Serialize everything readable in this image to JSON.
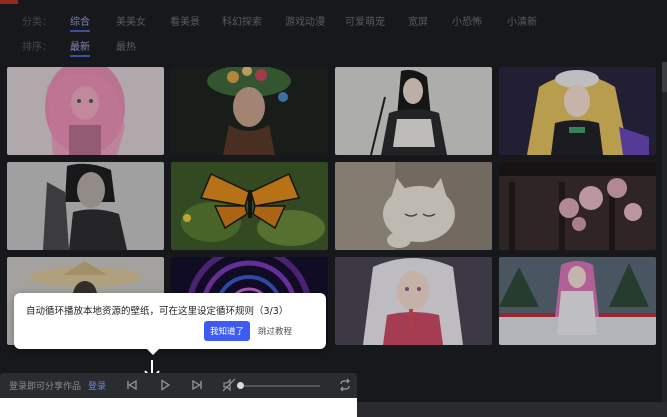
{
  "filters": {
    "category_label": "分类：",
    "categories": [
      "综合",
      "美美女",
      "看美景",
      "科幻探索",
      "游戏动漫",
      "可爱萌宠",
      "宽屏",
      "小恐怖",
      "小清新"
    ],
    "active_category": "综合",
    "sort_label": "排序：",
    "sorts": [
      "最新",
      "最热"
    ],
    "active_sort": "最新"
  },
  "thumbnails": [
    {
      "subject": "pink-hair-anime-girl"
    },
    {
      "subject": "flower-crown-girl"
    },
    {
      "subject": "ink-swordswoman"
    },
    {
      "subject": "blonde-captain"
    },
    {
      "subject": "tattoo-portrait"
    },
    {
      "subject": "butterfly"
    },
    {
      "subject": "cat"
    },
    {
      "subject": "cherry-blossom-pavilion"
    },
    {
      "subject": "straw-hat-figure"
    },
    {
      "subject": "vortex-tunnel"
    },
    {
      "subject": "white-hair-girl"
    },
    {
      "subject": "snowy-pink-hair-girl"
    }
  ],
  "guide": {
    "message": "自动循环播放本地资源的壁纸，可在这里设定循环规则（3/3）",
    "confirm_label": "我知道了",
    "skip_label": "跳过教程"
  },
  "player": {
    "prompt_text": "登录即可分享作品",
    "login_label": "登录"
  },
  "colors": {
    "accent": "#3d5bf0",
    "link": "#5c8cf0",
    "background": "#1d1e22"
  }
}
